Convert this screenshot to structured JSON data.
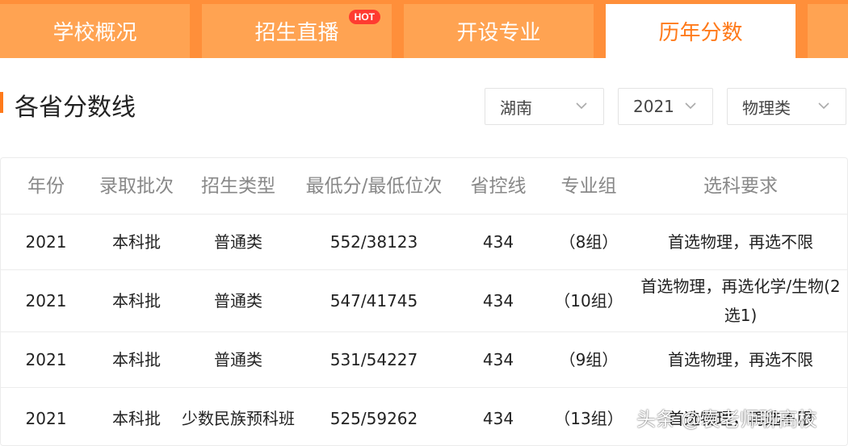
{
  "tabs": [
    {
      "label": "学校概况"
    },
    {
      "label": "招生直播",
      "badge": "HOT"
    },
    {
      "label": "开设专业"
    },
    {
      "label": "历年分数",
      "active": true
    }
  ],
  "section": {
    "title": "各省分数线"
  },
  "filters": {
    "province": "湖南",
    "year": "2021",
    "category": "物理类"
  },
  "table": {
    "headers": [
      "年份",
      "录取批次",
      "招生类型",
      "最低分/最低位次",
      "省控线",
      "专业组",
      "选科要求"
    ],
    "rows": [
      [
        "2021",
        "本科批",
        "普通类",
        "552/38123",
        "434",
        "（8组）",
        "首选物理，再选不限"
      ],
      [
        "2021",
        "本科批",
        "普通类",
        "547/41745",
        "434",
        "（10组）",
        "首选物理，再选化学/生物(2选1)"
      ],
      [
        "2021",
        "本科批",
        "普通类",
        "531/54227",
        "434",
        "（9组）",
        "首选物理，再选不限"
      ],
      [
        "2021",
        "本科批",
        "少数民族预科班",
        "525/59262",
        "434",
        "（13组）",
        "首选物理，再选不限"
      ]
    ]
  },
  "watermark": "头条 @袁老师聊高校",
  "colors": {
    "accent": "#ff7a1a",
    "tab_bg": "#ffa352",
    "hot_badge": "#ff3b30"
  }
}
